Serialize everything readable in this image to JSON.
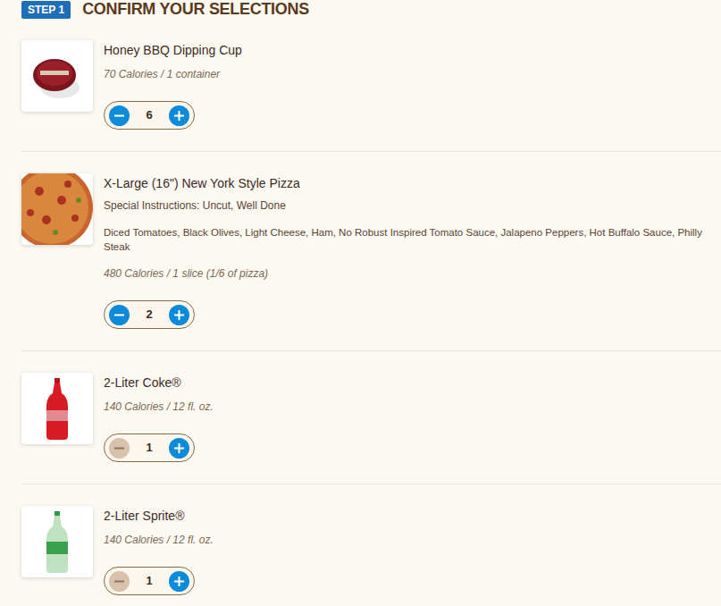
{
  "header": {
    "step": "STEP 1",
    "title": "CONFIRM YOUR SELECTIONS"
  },
  "items": [
    {
      "kind": "dip",
      "name": "Honey BBQ Dipping Cup",
      "calories": "70 Calories / 1 container",
      "quantity": "6",
      "minus_disabled": false
    },
    {
      "kind": "pizza",
      "name": "X-Large (16\") New York Style Pizza",
      "instructions": "Special Instructions: Uncut, Well Done",
      "toppings": "Diced Tomatoes, Black Olives, Light Cheese, Ham, No Robust Inspired Tomato Sauce, Jalapeno Peppers, Hot Buffalo Sauce, Philly Steak",
      "calories": "480 Calories / 1 slice (1/6 of pizza)",
      "quantity": "2",
      "minus_disabled": false
    },
    {
      "kind": "coke",
      "name": "2-Liter Coke®",
      "calories": "140 Calories / 12 fl. oz.",
      "quantity": "1",
      "minus_disabled": true
    },
    {
      "kind": "sprite",
      "name": "2-Liter Sprite®",
      "calories": "140 Calories / 12 fl. oz.",
      "quantity": "1",
      "minus_disabled": true
    }
  ]
}
